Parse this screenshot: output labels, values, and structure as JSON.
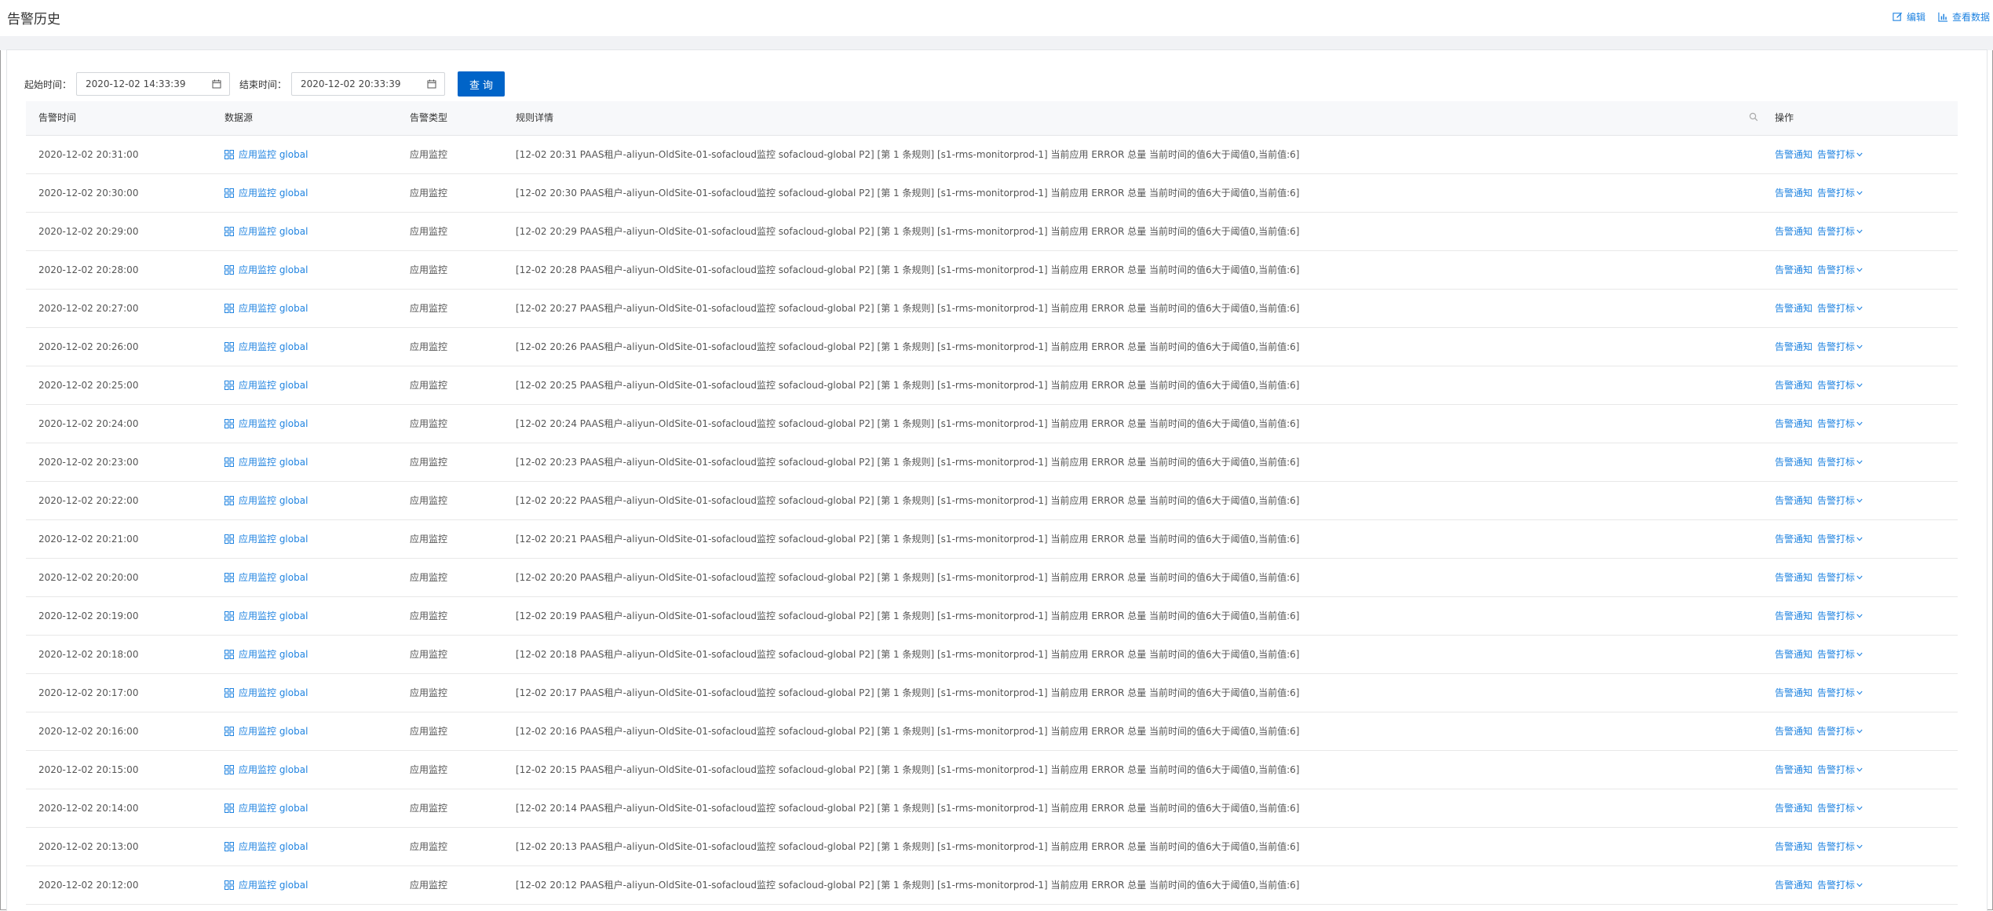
{
  "page": {
    "title": "告警历史",
    "actions": [
      {
        "label": "编辑",
        "icon": "edit-icon"
      },
      {
        "label": "查看数据",
        "icon": "bar-chart-icon"
      }
    ]
  },
  "filters": {
    "start_label": "起始时间：",
    "start_value": "2020-12-02 14:33:39",
    "end_label": "结束时间：",
    "end_value": "2020-12-02 20:33:39",
    "query_button": "查询"
  },
  "table": {
    "columns": [
      "告警时间",
      "数据源",
      "告警类型",
      "规则详情",
      "操作"
    ],
    "rows": [
      {
        "time": "2020-12-02 20:31:00",
        "source": "应用监控 global",
        "type": "应用监控",
        "detail": "[12-02 20:31 PAAS租户-aliyun-OldSite-01-sofacloud监控 sofacloud-global P2] [第 1 条规则] [s1-rms-monitorprod-1] 当前应用 ERROR 总量 当前时间的值6大于阈值0,当前值:6]",
        "action_notify": "告警通知",
        "action_mark": "告警打标"
      },
      {
        "time": "2020-12-02 20:30:00",
        "source": "应用监控 global",
        "type": "应用监控",
        "detail": "[12-02 20:30 PAAS租户-aliyun-OldSite-01-sofacloud监控 sofacloud-global P2] [第 1 条规则] [s1-rms-monitorprod-1] 当前应用 ERROR 总量 当前时间的值6大于阈值0,当前值:6]",
        "action_notify": "告警通知",
        "action_mark": "告警打标"
      },
      {
        "time": "2020-12-02 20:29:00",
        "source": "应用监控 global",
        "type": "应用监控",
        "detail": "[12-02 20:29 PAAS租户-aliyun-OldSite-01-sofacloud监控 sofacloud-global P2] [第 1 条规则] [s1-rms-monitorprod-1] 当前应用 ERROR 总量 当前时间的值6大于阈值0,当前值:6]",
        "action_notify": "告警通知",
        "action_mark": "告警打标"
      },
      {
        "time": "2020-12-02 20:28:00",
        "source": "应用监控 global",
        "type": "应用监控",
        "detail": "[12-02 20:28 PAAS租户-aliyun-OldSite-01-sofacloud监控 sofacloud-global P2] [第 1 条规则] [s1-rms-monitorprod-1] 当前应用 ERROR 总量 当前时间的值6大于阈值0,当前值:6]",
        "action_notify": "告警通知",
        "action_mark": "告警打标"
      },
      {
        "time": "2020-12-02 20:27:00",
        "source": "应用监控 global",
        "type": "应用监控",
        "detail": "[12-02 20:27 PAAS租户-aliyun-OldSite-01-sofacloud监控 sofacloud-global P2] [第 1 条规则] [s1-rms-monitorprod-1] 当前应用 ERROR 总量 当前时间的值6大于阈值0,当前值:6]",
        "action_notify": "告警通知",
        "action_mark": "告警打标"
      },
      {
        "time": "2020-12-02 20:26:00",
        "source": "应用监控 global",
        "type": "应用监控",
        "detail": "[12-02 20:26 PAAS租户-aliyun-OldSite-01-sofacloud监控 sofacloud-global P2] [第 1 条规则] [s1-rms-monitorprod-1] 当前应用 ERROR 总量 当前时间的值6大于阈值0,当前值:6]",
        "action_notify": "告警通知",
        "action_mark": "告警打标"
      },
      {
        "time": "2020-12-02 20:25:00",
        "source": "应用监控 global",
        "type": "应用监控",
        "detail": "[12-02 20:25 PAAS租户-aliyun-OldSite-01-sofacloud监控 sofacloud-global P2] [第 1 条规则] [s1-rms-monitorprod-1] 当前应用 ERROR 总量 当前时间的值6大于阈值0,当前值:6]",
        "action_notify": "告警通知",
        "action_mark": "告警打标"
      },
      {
        "time": "2020-12-02 20:24:00",
        "source": "应用监控 global",
        "type": "应用监控",
        "detail": "[12-02 20:24 PAAS租户-aliyun-OldSite-01-sofacloud监控 sofacloud-global P2] [第 1 条规则] [s1-rms-monitorprod-1] 当前应用 ERROR 总量 当前时间的值6大于阈值0,当前值:6]",
        "action_notify": "告警通知",
        "action_mark": "告警打标"
      },
      {
        "time": "2020-12-02 20:23:00",
        "source": "应用监控 global",
        "type": "应用监控",
        "detail": "[12-02 20:23 PAAS租户-aliyun-OldSite-01-sofacloud监控 sofacloud-global P2] [第 1 条规则] [s1-rms-monitorprod-1] 当前应用 ERROR 总量 当前时间的值6大于阈值0,当前值:6]",
        "action_notify": "告警通知",
        "action_mark": "告警打标"
      },
      {
        "time": "2020-12-02 20:22:00",
        "source": "应用监控 global",
        "type": "应用监控",
        "detail": "[12-02 20:22 PAAS租户-aliyun-OldSite-01-sofacloud监控 sofacloud-global P2] [第 1 条规则] [s1-rms-monitorprod-1] 当前应用 ERROR 总量 当前时间的值6大于阈值0,当前值:6]",
        "action_notify": "告警通知",
        "action_mark": "告警打标"
      },
      {
        "time": "2020-12-02 20:21:00",
        "source": "应用监控 global",
        "type": "应用监控",
        "detail": "[12-02 20:21 PAAS租户-aliyun-OldSite-01-sofacloud监控 sofacloud-global P2] [第 1 条规则] [s1-rms-monitorprod-1] 当前应用 ERROR 总量 当前时间的值6大于阈值0,当前值:6]",
        "action_notify": "告警通知",
        "action_mark": "告警打标"
      },
      {
        "time": "2020-12-02 20:20:00",
        "source": "应用监控 global",
        "type": "应用监控",
        "detail": "[12-02 20:20 PAAS租户-aliyun-OldSite-01-sofacloud监控 sofacloud-global P2] [第 1 条规则] [s1-rms-monitorprod-1] 当前应用 ERROR 总量 当前时间的值6大于阈值0,当前值:6]",
        "action_notify": "告警通知",
        "action_mark": "告警打标"
      },
      {
        "time": "2020-12-02 20:19:00",
        "source": "应用监控 global",
        "type": "应用监控",
        "detail": "[12-02 20:19 PAAS租户-aliyun-OldSite-01-sofacloud监控 sofacloud-global P2] [第 1 条规则] [s1-rms-monitorprod-1] 当前应用 ERROR 总量 当前时间的值6大于阈值0,当前值:6]",
        "action_notify": "告警通知",
        "action_mark": "告警打标"
      },
      {
        "time": "2020-12-02 20:18:00",
        "source": "应用监控 global",
        "type": "应用监控",
        "detail": "[12-02 20:18 PAAS租户-aliyun-OldSite-01-sofacloud监控 sofacloud-global P2] [第 1 条规则] [s1-rms-monitorprod-1] 当前应用 ERROR 总量 当前时间的值6大于阈值0,当前值:6]",
        "action_notify": "告警通知",
        "action_mark": "告警打标"
      },
      {
        "time": "2020-12-02 20:17:00",
        "source": "应用监控 global",
        "type": "应用监控",
        "detail": "[12-02 20:17 PAAS租户-aliyun-OldSite-01-sofacloud监控 sofacloud-global P2] [第 1 条规则] [s1-rms-monitorprod-1] 当前应用 ERROR 总量 当前时间的值6大于阈值0,当前值:6]",
        "action_notify": "告警通知",
        "action_mark": "告警打标"
      },
      {
        "time": "2020-12-02 20:16:00",
        "source": "应用监控 global",
        "type": "应用监控",
        "detail": "[12-02 20:16 PAAS租户-aliyun-OldSite-01-sofacloud监控 sofacloud-global P2] [第 1 条规则] [s1-rms-monitorprod-1] 当前应用 ERROR 总量 当前时间的值6大于阈值0,当前值:6]",
        "action_notify": "告警通知",
        "action_mark": "告警打标"
      },
      {
        "time": "2020-12-02 20:15:00",
        "source": "应用监控 global",
        "type": "应用监控",
        "detail": "[12-02 20:15 PAAS租户-aliyun-OldSite-01-sofacloud监控 sofacloud-global P2] [第 1 条规则] [s1-rms-monitorprod-1] 当前应用 ERROR 总量 当前时间的值6大于阈值0,当前值:6]",
        "action_notify": "告警通知",
        "action_mark": "告警打标"
      },
      {
        "time": "2020-12-02 20:14:00",
        "source": "应用监控 global",
        "type": "应用监控",
        "detail": "[12-02 20:14 PAAS租户-aliyun-OldSite-01-sofacloud监控 sofacloud-global P2] [第 1 条规则] [s1-rms-monitorprod-1] 当前应用 ERROR 总量 当前时间的值6大于阈值0,当前值:6]",
        "action_notify": "告警通知",
        "action_mark": "告警打标"
      },
      {
        "time": "2020-12-02 20:13:00",
        "source": "应用监控 global",
        "type": "应用监控",
        "detail": "[12-02 20:13 PAAS租户-aliyun-OldSite-01-sofacloud监控 sofacloud-global P2] [第 1 条规则] [s1-rms-monitorprod-1] 当前应用 ERROR 总量 当前时间的值6大于阈值0,当前值:6]",
        "action_notify": "告警通知",
        "action_mark": "告警打标"
      },
      {
        "time": "2020-12-02 20:12:00",
        "source": "应用监控 global",
        "type": "应用监控",
        "detail": "[12-02 20:12 PAAS租户-aliyun-OldSite-01-sofacloud监控 sofacloud-global P2] [第 1 条规则] [s1-rms-monitorprod-1] 当前应用 ERROR 总量 当前时间的值6大于阈值0,当前值:6]",
        "action_notify": "告警通知",
        "action_mark": "告警打标"
      }
    ]
  },
  "colors": {
    "link": "#1f83e0",
    "primary_button": "#0064c8",
    "header_bg": "#f7f8fa"
  }
}
